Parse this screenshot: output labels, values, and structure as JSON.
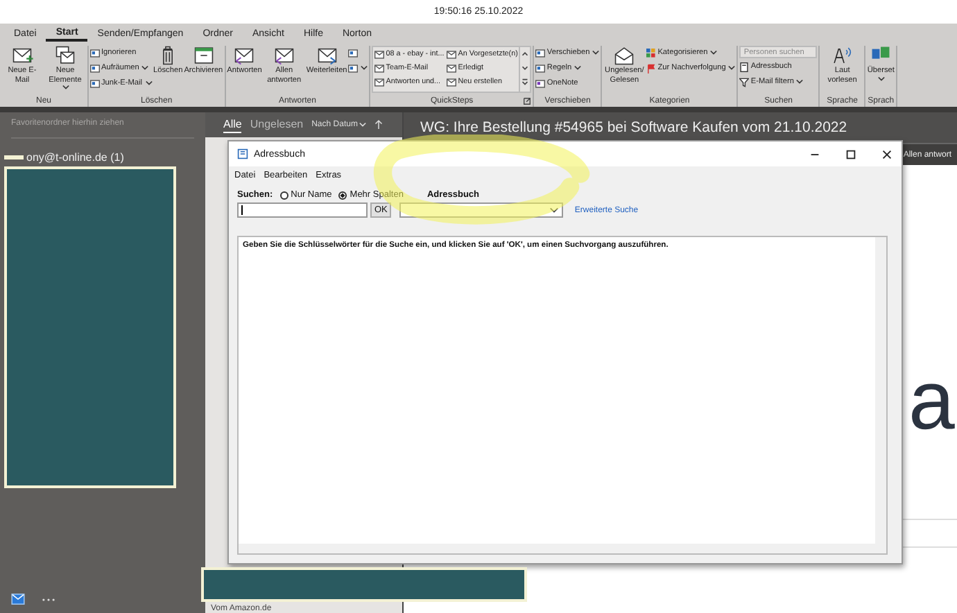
{
  "time": "19:50:16 25.10.2022",
  "ribbon": {
    "tabs": [
      {
        "label": "Datei",
        "selected": false
      },
      {
        "label": "Start",
        "selected": true
      },
      {
        "label": "Senden/Empfangen",
        "selected": false
      },
      {
        "label": "Ordner",
        "selected": false
      },
      {
        "label": "Ansicht",
        "selected": false
      },
      {
        "label": "Hilfe",
        "selected": false
      },
      {
        "label": "Norton",
        "selected": false
      }
    ],
    "groups": [
      {
        "label": "Neu",
        "launcher": false,
        "items": [
          {
            "label": "Neue E-Mail",
            "kind": "large",
            "dropdown": false
          },
          {
            "label": "Neue Elemente",
            "kind": "large",
            "dropdown": true
          }
        ]
      },
      {
        "label": "Löschen",
        "launcher": false,
        "items": [
          {
            "label": "Ignorieren",
            "kind": "small",
            "dropdown": false
          },
          {
            "label": "Aufräumen",
            "kind": "small",
            "dropdown": true
          },
          {
            "label": "Junk-E-Mail",
            "kind": "small",
            "dropdown": true
          },
          {
            "label": "Löschen",
            "kind": "large",
            "dropdown": false
          },
          {
            "label": "Archivieren",
            "kind": "large",
            "dropdown": false
          }
        ]
      },
      {
        "label": "Antworten",
        "launcher": false,
        "items": [
          {
            "label": "Antworten",
            "kind": "large",
            "dropdown": false
          },
          {
            "label": "Allen antworten",
            "kind": "large",
            "dropdown": false
          },
          {
            "label": "Weiterleiten",
            "kind": "large",
            "dropdown": false
          },
          {
            "kind": "icon",
            "dropdown": false
          },
          {
            "kind": "icon",
            "dropdown": true
          }
        ]
      },
      {
        "label": "QuickSteps",
        "launcher": true,
        "items": [
          {
            "label": "08 a - ebay - int...",
            "kind": "quickstep"
          },
          {
            "label": "Team-E-Mail",
            "kind": "quickstep"
          },
          {
            "label": "Antworten und...",
            "kind": "quickstep"
          },
          {
            "label": "An Vorgesetzte(n)",
            "kind": "quickstep"
          },
          {
            "label": "Erledigt",
            "kind": "quickstep"
          },
          {
            "label": "Neu erstellen",
            "kind": "quickstep"
          }
        ]
      },
      {
        "label": "Verschieben",
        "launcher": false,
        "items": [
          {
            "label": "Verschieben",
            "kind": "small",
            "dropdown": true
          },
          {
            "label": "Regeln",
            "kind": "small",
            "dropdown": true
          },
          {
            "label": "OneNote",
            "kind": "small",
            "dropdown": false
          }
        ]
      },
      {
        "label": "Kategorien",
        "launcher": false,
        "items": [
          {
            "label": "Ungelesen/ Gelesen",
            "kind": "large",
            "dropdown": false
          },
          {
            "label": "Kategorisieren",
            "kind": "small",
            "dropdown": true
          },
          {
            "label": "Zur Nachverfolgung",
            "kind": "small",
            "dropdown": true
          }
        ]
      },
      {
        "label": "Suchen",
        "launcher": false,
        "items": [
          {
            "placeholder": "Personen suchen",
            "kind": "search"
          },
          {
            "label": "Adressbuch",
            "kind": "small",
            "dropdown": false
          },
          {
            "label": "E-Mail filtern",
            "kind": "small",
            "dropdown": true
          }
        ]
      },
      {
        "label": "Sprache",
        "launcher": false,
        "items": [
          {
            "label": "Laut vorlesen",
            "kind": "large",
            "dropdown": false
          }
        ]
      },
      {
        "label": "Sprach",
        "launcher": false,
        "items": [
          {
            "label": "Überset",
            "kind": "large",
            "dropdown": true
          }
        ]
      }
    ]
  },
  "folders": {
    "hint": "Favoritenordner hierhin ziehen",
    "account": "ony@t-online.de (1)"
  },
  "message_list": {
    "filters": [
      {
        "label": "Alle",
        "selected": true
      },
      {
        "label": "Ungelesen",
        "selected": false
      }
    ],
    "sort": "Nach Datum",
    "bottom_text": "Vom Amazon.de"
  },
  "reading_pane": {
    "subject": "WG: Ihre Bestellung #54965 bei Software Kaufen vom 21.10.2022",
    "reply_button": "Allen antwort",
    "body_text": "a"
  },
  "dialog": {
    "title": "Adressbuch",
    "menu": [
      "Datei",
      "Bearbeiten",
      "Extras"
    ],
    "search_label": "Suchen:",
    "search_modes": [
      {
        "label": "Nur Name",
        "selected": false
      },
      {
        "label": "Mehr Spalten",
        "selected": true
      }
    ],
    "book_label": "Adressbuch",
    "ok_button": "OK",
    "advanced_link": "Erweiterte Suche",
    "results_hint": "Geben Sie die Schlüsselwörter für die Suche ein, und klicken Sie auf 'OK', um einen Suchvorgang auszuführen."
  }
}
